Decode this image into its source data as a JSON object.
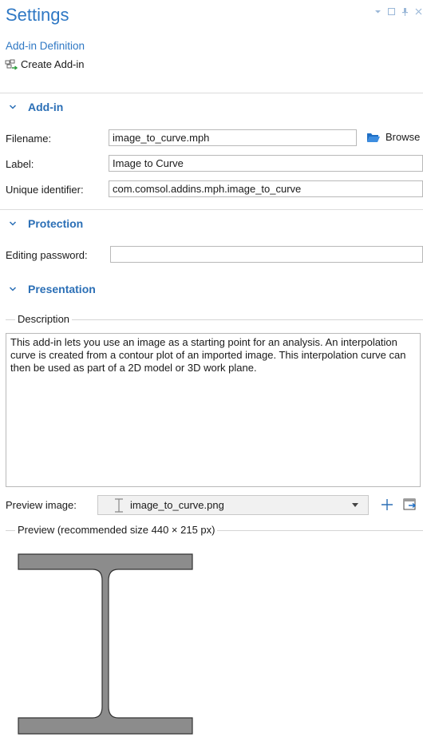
{
  "header": {
    "title": "Settings",
    "subtitle": "Add-in Definition",
    "create_label": "Create Add-in"
  },
  "sections": {
    "addin": {
      "title": "Add-in",
      "filename_label": "Filename:",
      "filename_value": "image_to_curve.mph",
      "browse_label": "Browse",
      "label_label": "Label:",
      "label_value": "Image to Curve",
      "uid_label": "Unique identifier:",
      "uid_value": "com.comsol.addins.mph.image_to_curve"
    },
    "protection": {
      "title": "Protection",
      "password_label": "Editing password:",
      "password_value": ""
    },
    "presentation": {
      "title": "Presentation",
      "description_group": "Description",
      "description_text": "This add-in lets you use an image as a starting point for an analysis. An interpolation curve is created from a contour plot of an imported image. This interpolation curve can then be used as part of a 2D model or 3D work plane.",
      "preview_image_label": "Preview image:",
      "preview_image_value": "image_to_curve.png",
      "preview_group": "Preview (recommended size 440 × 215 px)"
    }
  },
  "colors": {
    "accent": "#2f78c4",
    "section_header": "#2b6fb6",
    "beam_fill": "#8c8c8c",
    "beam_stroke": "#333333"
  },
  "icons": {
    "window_controls": [
      "dropdown-icon",
      "maximize-icon",
      "pin-icon",
      "close-icon"
    ],
    "create": "create-addin-icon",
    "browse": "folder-icon",
    "add": "plus-icon",
    "import": "import-icon"
  }
}
